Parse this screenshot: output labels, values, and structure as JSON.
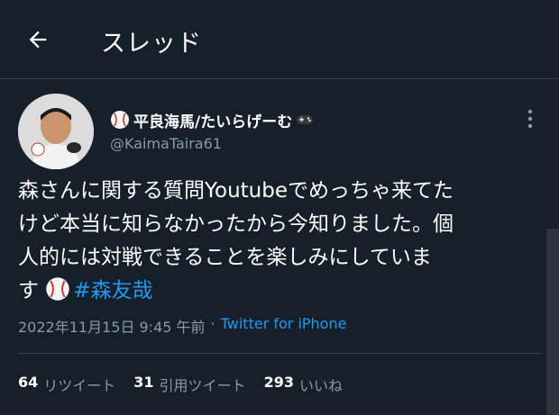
{
  "header": {
    "title": "スレッド",
    "back_icon": "arrow-left-icon"
  },
  "tweet": {
    "display_name": "平良海馬/たいらげーむ",
    "handle": "@KaimaTaira61",
    "text_lines": [
      "森さんに関する質問Youtubeでめっちゃ来てた",
      "けど本当に知らなかったから今知りました。個",
      "人的には対戦できることを楽しみにしていま",
      "す"
    ],
    "hashtag": "#森友哉",
    "timestamp": "2022年11月15日 9:45 午前",
    "separator": "·",
    "source": "Twitter for iPhone",
    "name_emojis": [
      "baseball-icon",
      "game-controller-icon"
    ],
    "inline_emoji": "baseball-icon"
  },
  "stats": [
    {
      "count": "64",
      "label": "リツイート"
    },
    {
      "count": "31",
      "label": "引用ツイート"
    },
    {
      "count": "293",
      "label": "いいね"
    }
  ],
  "colors": {
    "background": "#15202b",
    "link": "#1d9bf0",
    "secondary_text": "#8b98a5",
    "divider": "#38444d"
  }
}
